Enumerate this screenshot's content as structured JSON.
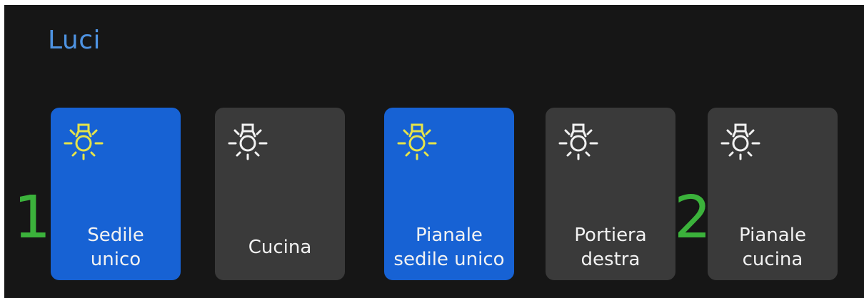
{
  "header": {
    "title": "Luci"
  },
  "markers": [
    "1",
    "2"
  ],
  "colors": {
    "background": "#161616",
    "title": "#4e93e2",
    "tile_on": "#1762d4",
    "tile_off": "#3a3a3a",
    "bulb_on": "#e6e44a",
    "bulb_off": "#f2f2f2",
    "marker": "#3bb23b"
  },
  "lights": [
    {
      "label": "Sedile\nunico",
      "state": "on",
      "icon": "light-bulb-icon"
    },
    {
      "label": "Cucina",
      "state": "off",
      "icon": "light-bulb-icon"
    },
    {
      "label": "Pianale\nsedile unico",
      "state": "on",
      "icon": "light-bulb-icon"
    },
    {
      "label": "Portiera\ndestra",
      "state": "off",
      "icon": "light-bulb-icon"
    },
    {
      "label": "Pianale\ncucina",
      "state": "off",
      "icon": "light-bulb-icon"
    }
  ]
}
